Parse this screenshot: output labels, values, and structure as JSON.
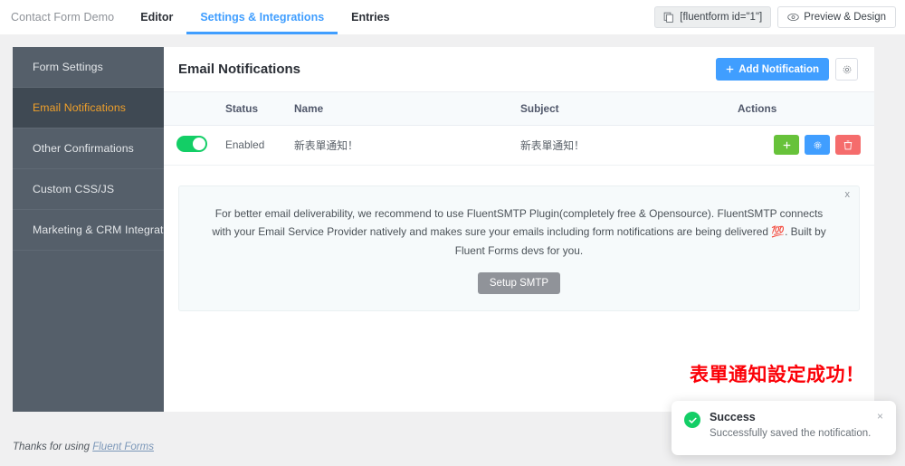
{
  "topbar": {
    "form_title": "Contact Form Demo",
    "tabs": [
      {
        "label": "Editor",
        "active": false
      },
      {
        "label": "Settings & Integrations",
        "active": true
      },
      {
        "label": "Entries",
        "active": false
      }
    ],
    "shortcode_button": "[fluentform id=\"1\"]",
    "shortcode_icon": "copy-icon",
    "preview_button": "Preview & Design",
    "preview_icon": "eye-icon",
    "active_accent_color": "#409eff"
  },
  "sidebar": {
    "items": [
      {
        "label": "Form Settings",
        "active": false
      },
      {
        "label": "Email Notifications",
        "active": true
      },
      {
        "label": "Other Confirmations",
        "active": false
      },
      {
        "label": "Custom CSS/JS",
        "active": false
      },
      {
        "label": "Marketing & CRM Integrations",
        "active": false
      }
    ],
    "background_color": "#555f6a",
    "active_background_color": "#3f4953",
    "active_text_color": "#f0a02a"
  },
  "main": {
    "title": "Email Notifications",
    "add_button": "Add Notification",
    "add_button_icon": "plus-icon",
    "add_button_color": "#409eff",
    "settings_icon": "gear-icon",
    "table": {
      "columns": [
        "",
        "Status",
        "Name",
        "Subject",
        "Actions"
      ],
      "rows": [
        {
          "enabled": true,
          "status": "Enabled",
          "name": "新表單通知！",
          "subject": "新表單通知！",
          "actions": [
            {
              "name": "duplicate-notification-button",
              "icon": "plus-icon",
              "color": "#67c23a"
            },
            {
              "name": "edit-notification-button",
              "icon": "gear-icon",
              "color": "#409eff"
            },
            {
              "name": "delete-notification-button",
              "icon": "trash-icon",
              "color": "#f56c6c"
            }
          ]
        }
      ]
    },
    "notice": {
      "text": "For better email deliverability, we recommend to use FluentSMTP Plugin(completely free & Opensource). FluentSMTP connects with your Email Service Provider natively and makes sure your emails including form notifications are being delivered 💯. Built by Fluent Forms devs for you.",
      "button": "Setup SMTP",
      "close_label": "x"
    }
  },
  "annotation": {
    "text": "表單通知設定成功！",
    "color": "#fb0007"
  },
  "toast": {
    "icon": "success-check-icon",
    "title": "Success",
    "message": "Successfully saved the notification.",
    "close_label": "×",
    "accent_color": "#13ce66"
  },
  "footer": {
    "thanks_text": "Thanks for using ",
    "link_text": "Fluent Forms",
    "version": ""
  }
}
